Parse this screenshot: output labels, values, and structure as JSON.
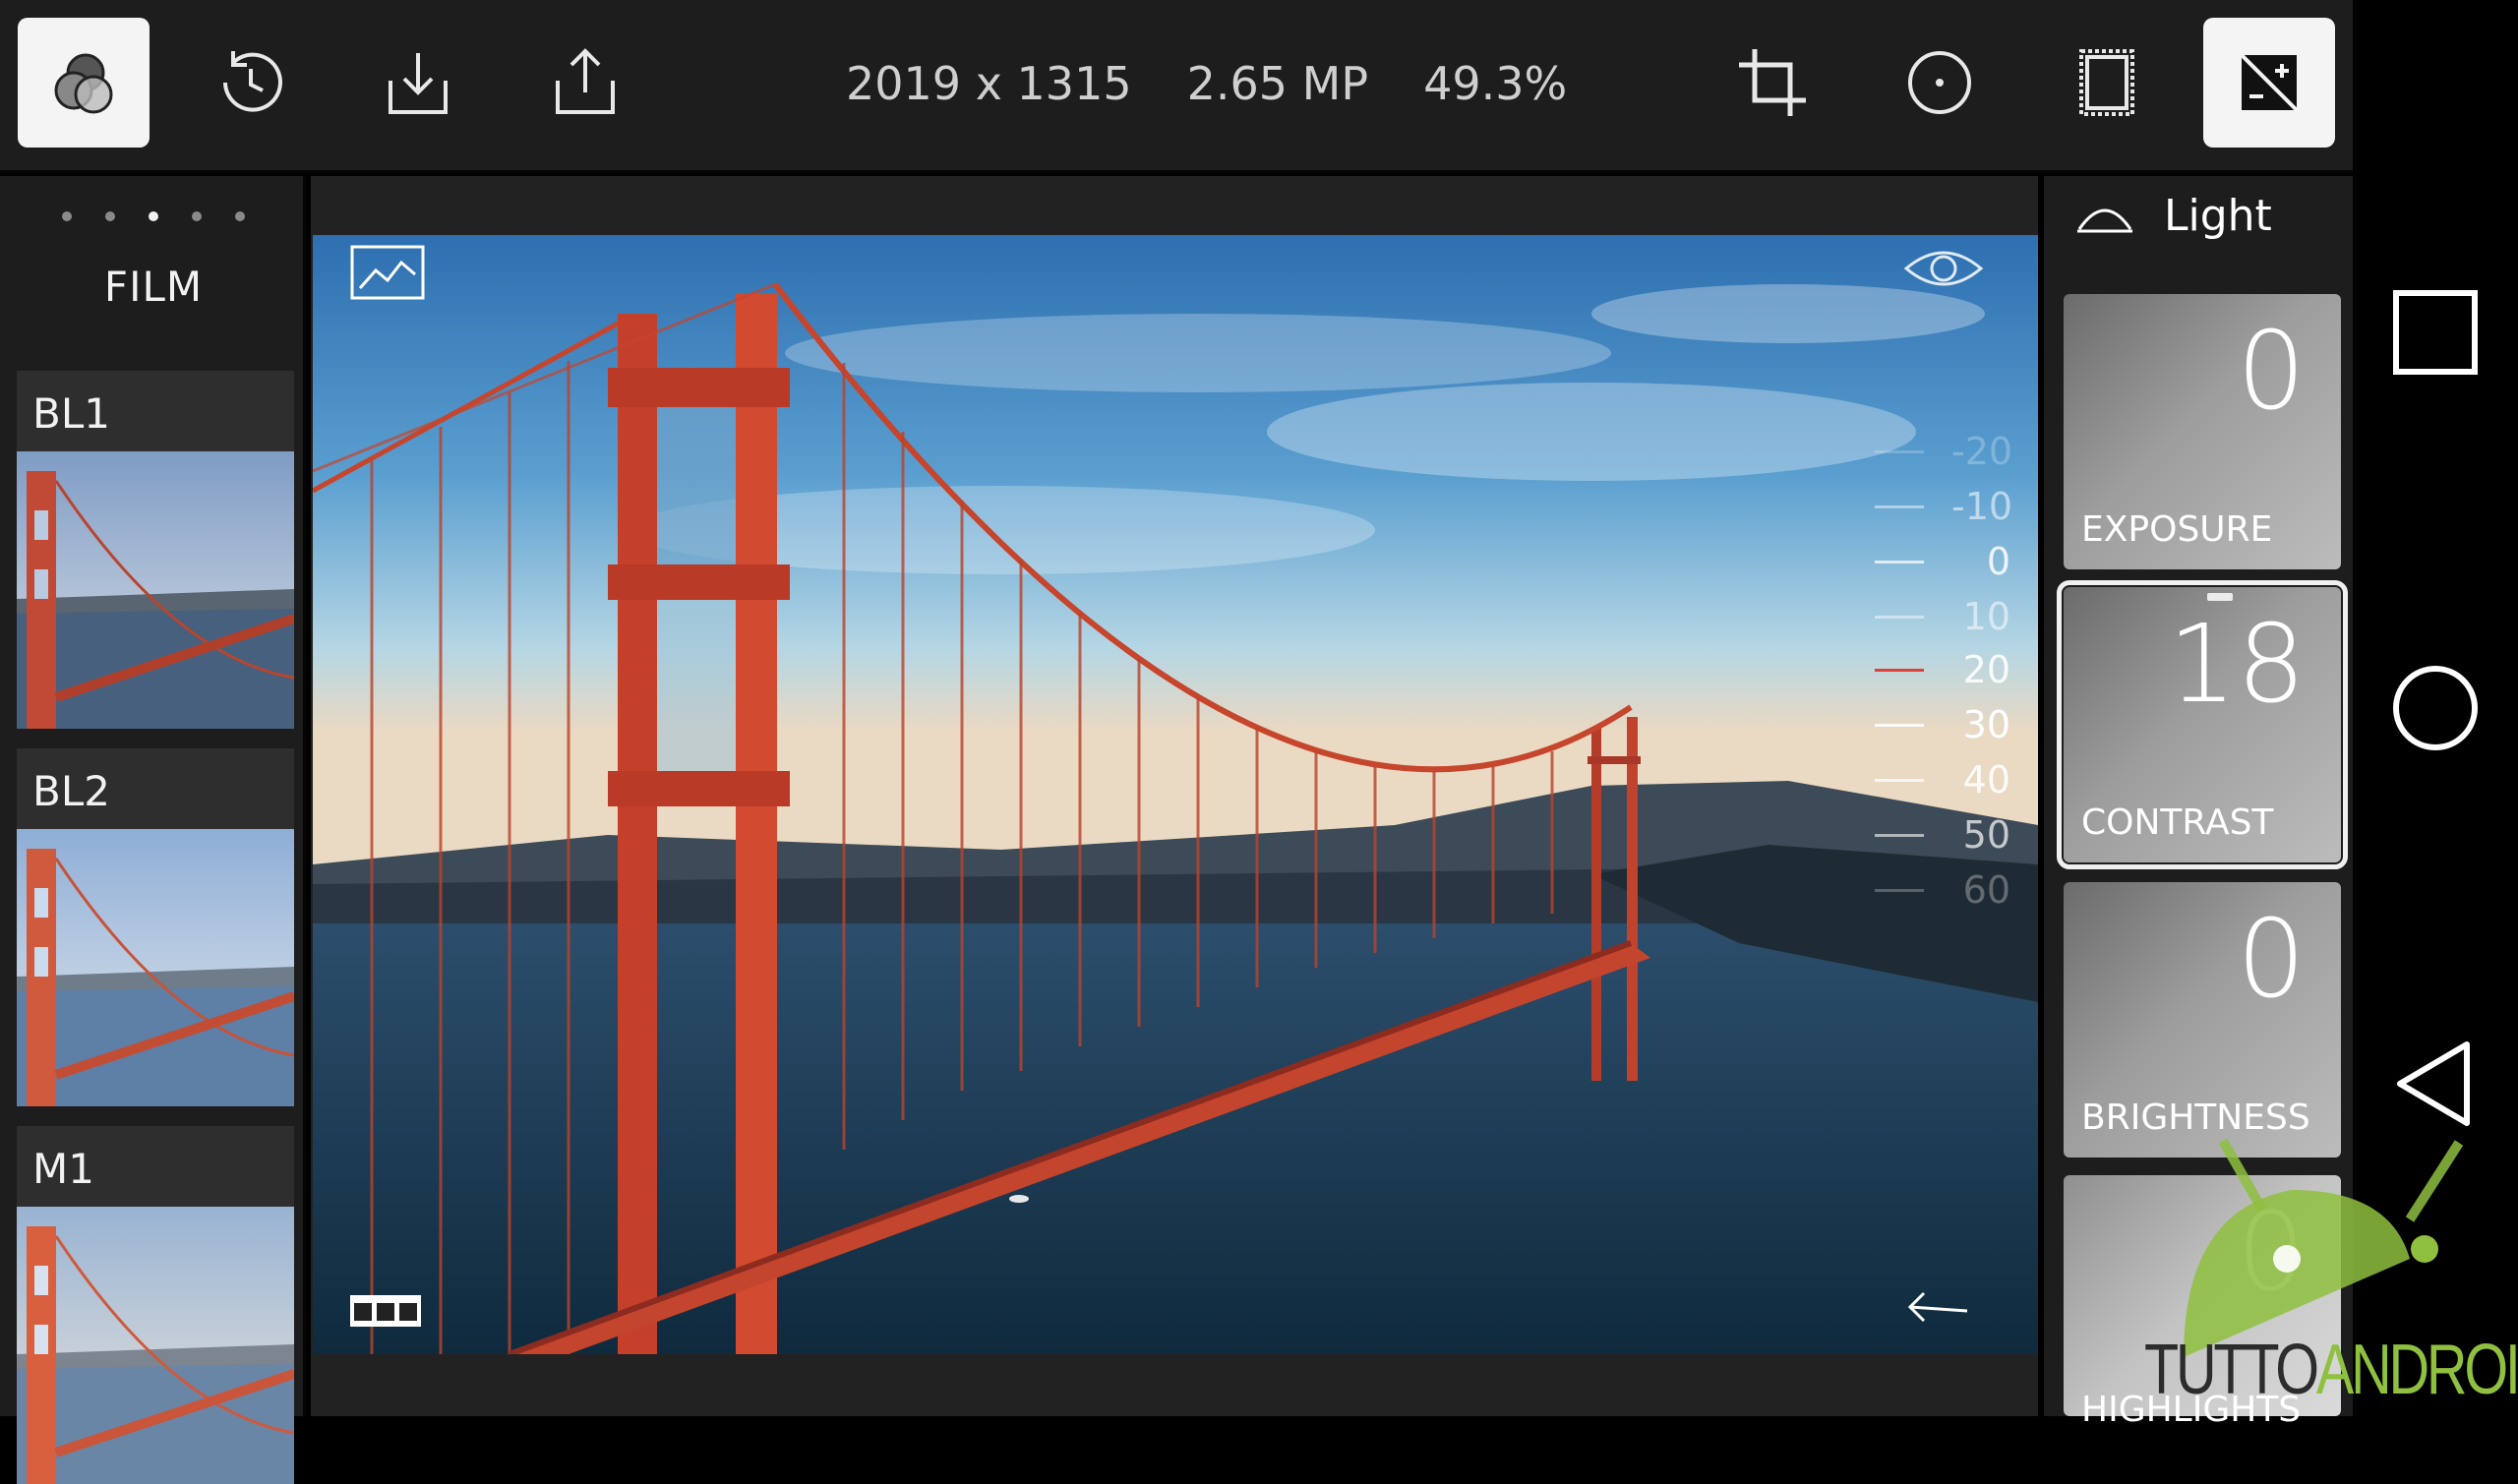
{
  "toolbar": {
    "buttons": [
      {
        "icon": "filters-icon",
        "active": true
      },
      {
        "icon": "history-icon",
        "active": false
      },
      {
        "icon": "download-icon",
        "active": false
      },
      {
        "icon": "share-icon",
        "active": false
      },
      {
        "icon": "crop-icon",
        "active": false
      },
      {
        "icon": "circle-icon",
        "active": false
      },
      {
        "icon": "frame-icon",
        "active": false
      },
      {
        "icon": "adjust-exposure-icon",
        "active": true
      }
    ],
    "resolution": "2019 x 1315",
    "megapixels": "2.65 MP",
    "zoom": "49.3%"
  },
  "film_panel": {
    "page_dots": 5,
    "active_dot": 2,
    "title": "FILM",
    "presets": [
      {
        "label": "BL1"
      },
      {
        "label": "BL2"
      },
      {
        "label": "M1"
      }
    ]
  },
  "canvas": {
    "scale_ticks": [
      "-20",
      "-10",
      "0",
      "10",
      "20",
      "30",
      "40",
      "50",
      "60"
    ],
    "scale_current": "20",
    "icons": {
      "top_left": "histogram-icon",
      "top_right": "eye-icon",
      "bottom_left": "strip-icon",
      "bottom_right": "back-arrow-icon"
    }
  },
  "adjust_panel": {
    "group_label": "Light",
    "items": [
      {
        "label": "EXPOSURE",
        "value": "0"
      },
      {
        "label": "CONTRAST",
        "value": "18",
        "selected": true
      },
      {
        "label": "BRIGHTNESS",
        "value": "0"
      },
      {
        "label": "HIGHLIGHTS",
        "value": "0"
      }
    ]
  },
  "watermark": {
    "brand_a": "TUTTO",
    "brand_b": "ANDROID"
  },
  "colors": {
    "bar_bg": "#1d1d1d",
    "accent_red": "#e0312a",
    "bridge": "#d2452b",
    "watermark_green": "#8fc040"
  }
}
